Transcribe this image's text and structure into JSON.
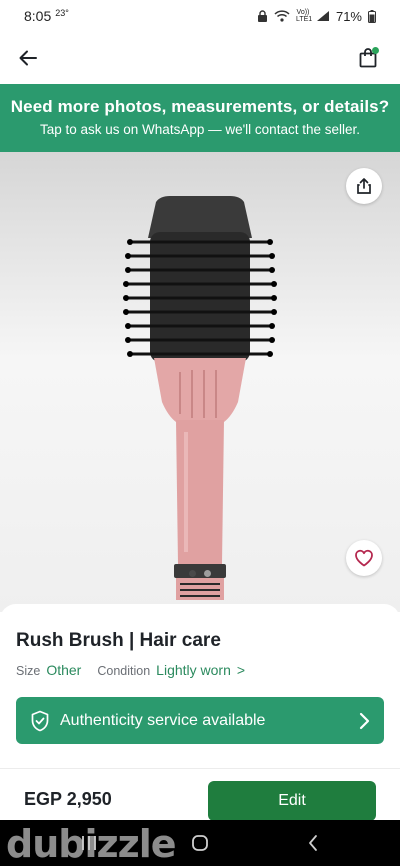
{
  "status_bar": {
    "time": "8:05",
    "temperature": "23°",
    "volte": "Vo)) LTE1",
    "battery": "71%"
  },
  "app_bar": {
    "back_icon": "arrow-left-icon",
    "bag_icon": "shopping-bag-icon"
  },
  "banner": {
    "title": "Need more photos, measurements, or details?",
    "subtitle": "Tap to ask us on WhatsApp — we'll contact the seller."
  },
  "gallery": {
    "image_subject": "hair-dryer-brush",
    "share_icon": "share-icon",
    "favorite_icon": "heart-icon",
    "image_count": 2,
    "active_index": 0
  },
  "listing": {
    "title": "Rush Brush | Hair care",
    "size_label": "Size",
    "size_value": "Other",
    "condition_label": "Condition",
    "condition_value": "Lightly worn",
    "condition_chevron": ">"
  },
  "authenticity": {
    "label": "Authenticity service available",
    "icon": "shield-check-icon"
  },
  "purchase": {
    "price": "EGP 2,950",
    "edit_label": "Edit"
  },
  "watermark": "dubizzle",
  "colors": {
    "accent_green": "#2b9a6e",
    "edit_button": "#1f7d3e",
    "link_green": "#2b8a5e",
    "brush_body": "#e0a1a1",
    "brush_bristles": "#1e1e1e"
  }
}
